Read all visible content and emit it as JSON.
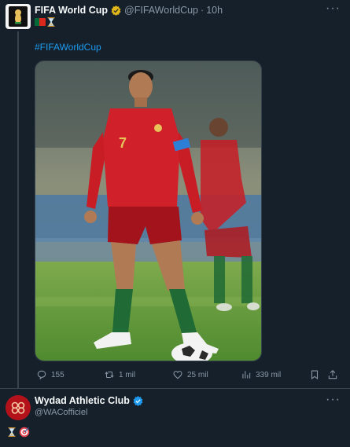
{
  "tweet1": {
    "author_name": "FIFA World Cup",
    "author_handle": "@FIFAWorldCup",
    "separator": "·",
    "time": "10h",
    "more_label": "···",
    "hashtag": "#FIFAWorldCup",
    "photo_alt": "Cristiano Ronaldo standing behind a ball in a red Portugal kit",
    "player_number": "7",
    "stats": {
      "replies": "155",
      "reposts": "1 mil",
      "likes": "25 mil",
      "views": "339 mil"
    }
  },
  "tweet2": {
    "author_name": "Wydad Athletic Club",
    "author_handle": "@WACofficiel",
    "more_label": "···"
  },
  "colors": {
    "background": "#15202b",
    "link": "#1d9bf0",
    "muted": "#8b98a5",
    "verified_gold": "#e2b719",
    "verified_blue": "#1d9bf0",
    "divider": "#38444d"
  },
  "icons": [
    "fifa-logo",
    "verified-gold-badge",
    "portugal-flag",
    "hourglass",
    "reply-icon",
    "repost-icon",
    "like-icon",
    "views-icon",
    "bookmark-icon",
    "share-icon",
    "wac-logo",
    "verified-blue-badge",
    "target-icon"
  ]
}
